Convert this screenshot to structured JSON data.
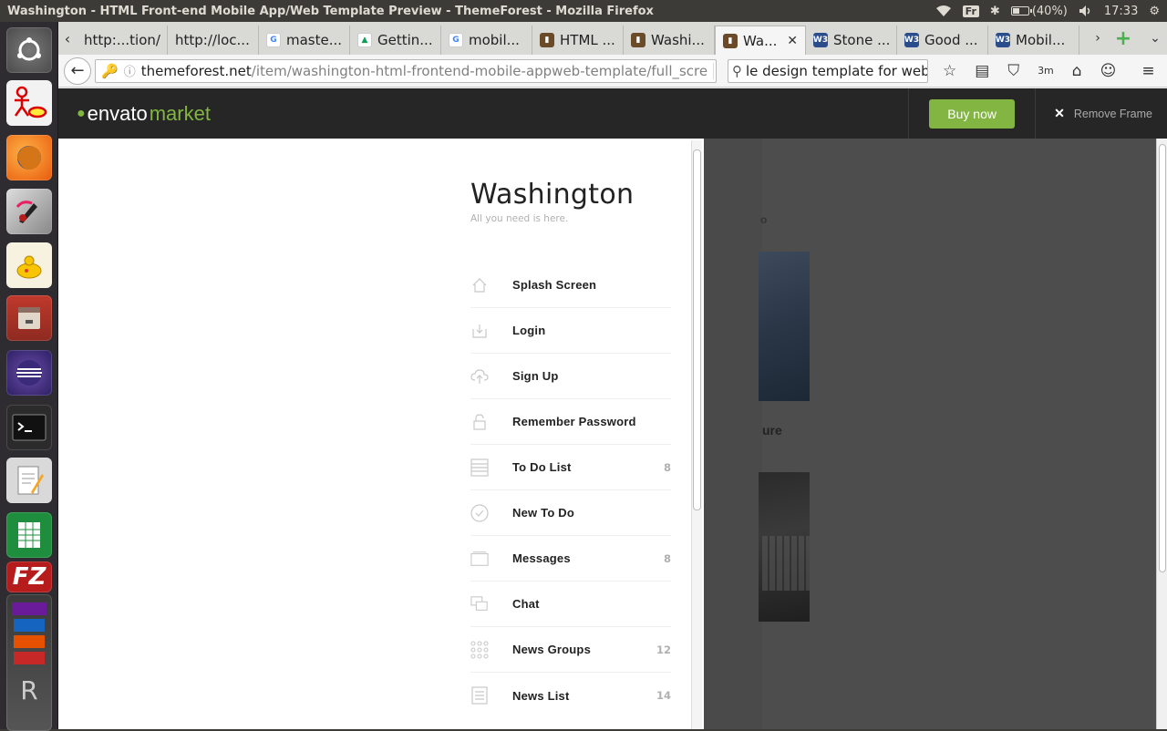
{
  "window": {
    "title": "Washington - HTML Front-end Mobile App/Web Template Preview - ThemeForest - Mozilla Firefox"
  },
  "top_panel": {
    "keyboard": "Fr",
    "battery": "(40%)",
    "time": "17:33"
  },
  "launcher": {
    "apps": [
      "ubuntu-dash-icon",
      "uml-tool-icon",
      "firefox-icon",
      "color-picker-icon",
      "genie-lamp-icon",
      "file-manager-icon",
      "eclipse-icon",
      "terminal-icon",
      "text-editor-icon",
      "spreadsheet-icon",
      "filezilla-icon",
      "stacked-apps-icon"
    ]
  },
  "tabs": [
    {
      "label": "http:...tion/",
      "icon": "none"
    },
    {
      "label": "http://loc...",
      "icon": "none"
    },
    {
      "label": "maste...",
      "icon": "google-icon"
    },
    {
      "label": "Gettin...",
      "icon": "google-drive-icon"
    },
    {
      "label": "mobil...",
      "icon": "google-icon"
    },
    {
      "label": "HTML ...",
      "icon": "themeforest-icon"
    },
    {
      "label": "Washi...",
      "icon": "themeforest-icon"
    },
    {
      "label": "Wa...",
      "icon": "themeforest-icon",
      "active": true
    },
    {
      "label": "Stone ...",
      "icon": "w3schools-icon"
    },
    {
      "label": "Good ...",
      "icon": "w3schools-icon"
    },
    {
      "label": "Mobil...",
      "icon": "w3schools-icon"
    }
  ],
  "navbar": {
    "url_host": "themeforest.net",
    "url_path": "/item/washington-html-frontend-mobile-appweb-template/full_scre",
    "search_value": "le design template for web",
    "download_badge": "3m"
  },
  "envato": {
    "logo_envato": "envato",
    "logo_market": "market",
    "buy_label": "Buy now",
    "remove_frame_label": "Remove Frame"
  },
  "app": {
    "title": "Washington",
    "subtitle": "All you need is here.",
    "peek_text_1": "o",
    "peek_text_2": "ure",
    "menu": [
      {
        "label": "Splash Screen",
        "icon": "home-icon",
        "count": ""
      },
      {
        "label": "Login",
        "icon": "download-box-icon",
        "count": ""
      },
      {
        "label": "Sign Up",
        "icon": "cloud-upload-icon",
        "count": ""
      },
      {
        "label": "Remember Password",
        "icon": "lock-icon",
        "count": ""
      },
      {
        "label": "To Do List",
        "icon": "list-icon",
        "count": "8"
      },
      {
        "label": "New To Do",
        "icon": "check-circle-icon",
        "count": ""
      },
      {
        "label": "Messages",
        "icon": "inbox-icon",
        "count": "8"
      },
      {
        "label": "Chat",
        "icon": "chat-bubbles-icon",
        "count": ""
      },
      {
        "label": "News Groups",
        "icon": "grid-dots-icon",
        "count": "12"
      },
      {
        "label": "News List",
        "icon": "news-list-icon",
        "count": "14"
      }
    ]
  },
  "colors": {
    "envato_green": "#82b541",
    "header_bg": "#262626",
    "overlay_gray": "#4d4d4d"
  }
}
